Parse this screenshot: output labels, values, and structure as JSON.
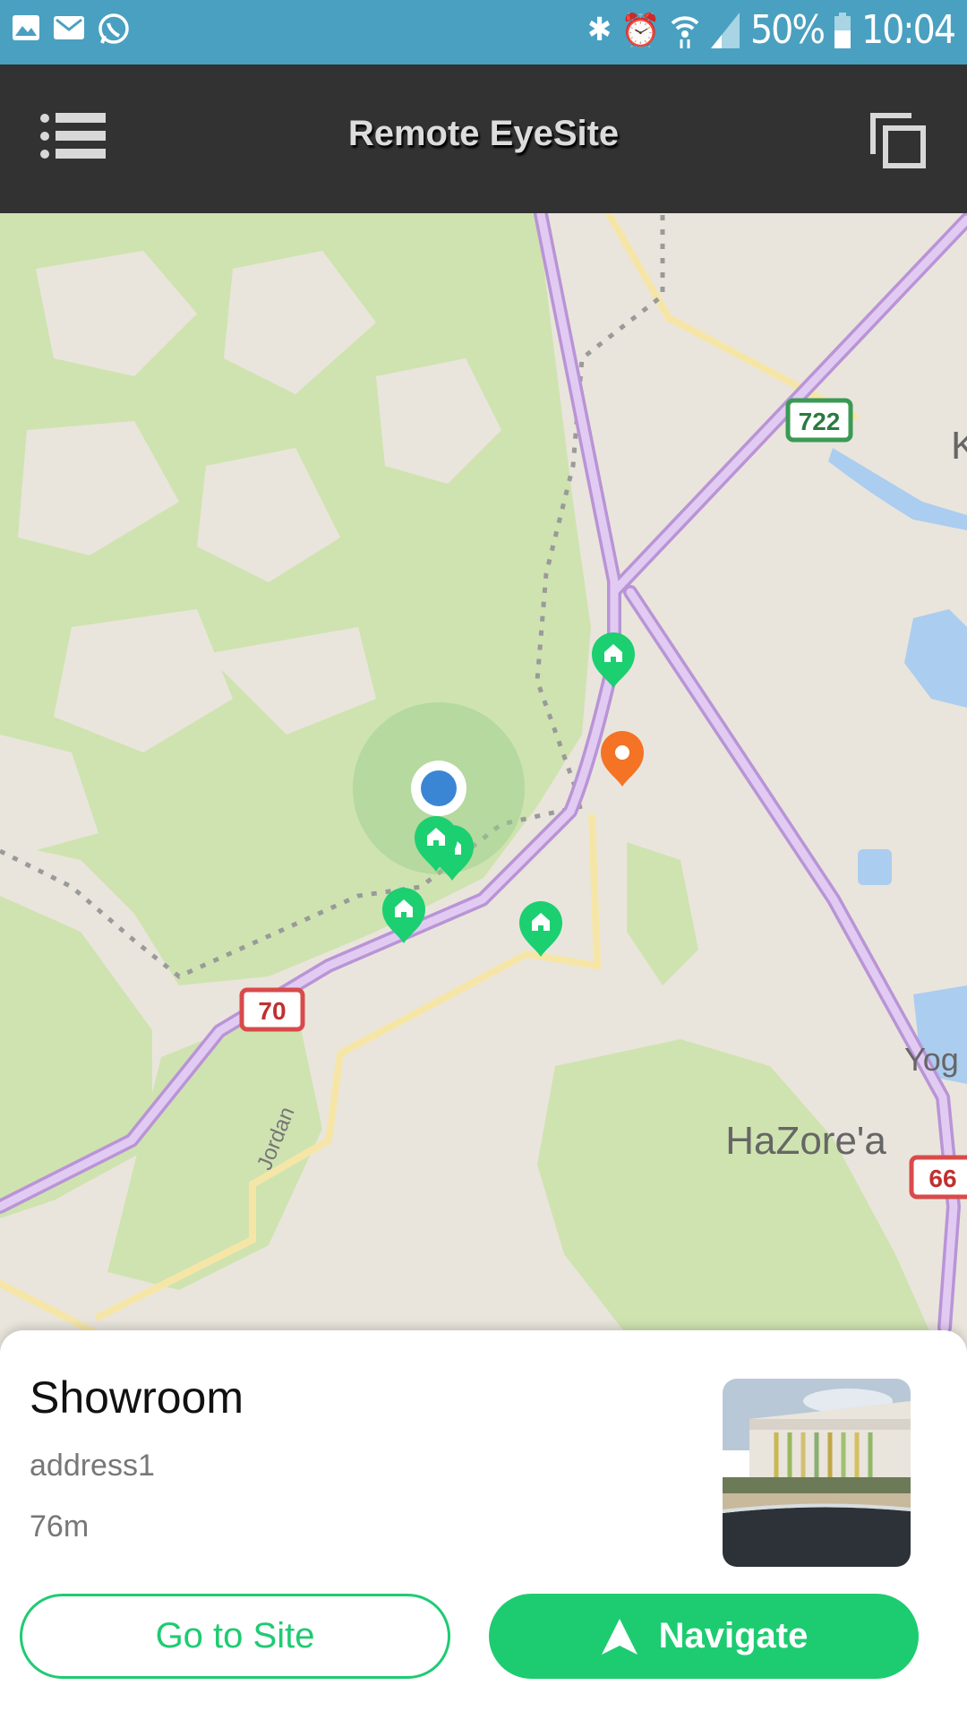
{
  "status_bar": {
    "battery": "50%",
    "time": "10:04",
    "left_icons": [
      "image-icon",
      "email-icon",
      "whatsapp-icon"
    ],
    "right_icons": [
      "bluetooth-icon",
      "alarm-icon",
      "wifi-icon",
      "signal-icon",
      "battery-icon"
    ],
    "color": "#4aa0c0"
  },
  "toolbar": {
    "title": "Remote EyeSite",
    "menu_icon": "list-menu-icon",
    "right_icon": "windows-icon"
  },
  "map": {
    "labels": {
      "route_722": "722",
      "route_70": "70",
      "route_66": "66",
      "town": "HaZore'a",
      "river": "Jordan",
      "partial_right": "Yog",
      "partial_top": "K"
    }
  },
  "card": {
    "name": "Showroom",
    "address": "address1",
    "distance": "76m",
    "go_to_site": "Go to Site",
    "navigate": "Navigate",
    "accent": "#1dcc70"
  }
}
